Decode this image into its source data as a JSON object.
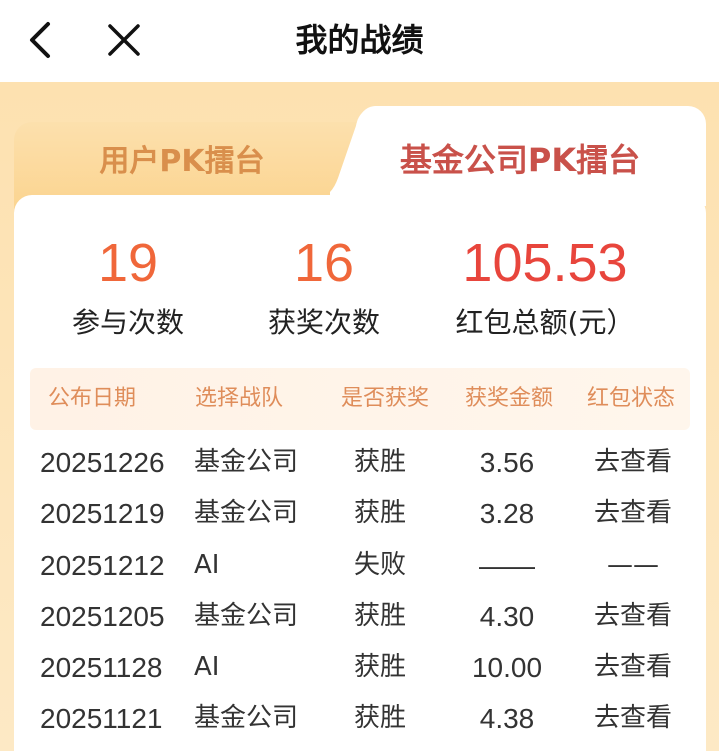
{
  "header": {
    "title": "我的战绩",
    "back_icon": "chevron-left-icon",
    "close_icon": "close-icon"
  },
  "tabs": [
    {
      "label": "用户PK擂台",
      "active": false
    },
    {
      "label": "基金公司PK擂台",
      "active": true
    }
  ],
  "stats": [
    {
      "value": "19",
      "label": "参与次数"
    },
    {
      "value": "16",
      "label": "获奖次数"
    },
    {
      "value": "105.53",
      "label": "红包总额(元）"
    }
  ],
  "table": {
    "columns": [
      "公布日期",
      "选择战队",
      "是否获奖",
      "获奖金额",
      "红包状态"
    ],
    "rows": [
      {
        "date": "20251226",
        "team": "基金公司",
        "result": "获胜",
        "amount": "3.56",
        "status": "去查看"
      },
      {
        "date": "20251219",
        "team": "基金公司",
        "result": "获胜",
        "amount": "3.28",
        "status": "去查看"
      },
      {
        "date": "20251212",
        "team": "AI",
        "result": "失败",
        "amount": "——",
        "status": "——"
      },
      {
        "date": "20251205",
        "team": "基金公司",
        "result": "获胜",
        "amount": "4.30",
        "status": "去查看"
      },
      {
        "date": "20251128",
        "team": "AI",
        "result": "获胜",
        "amount": "10.00",
        "status": "去查看"
      },
      {
        "date": "20251121",
        "team": "基金公司",
        "result": "获胜",
        "amount": "4.38",
        "status": "去查看"
      }
    ]
  },
  "colors": {
    "accent_orange": "#f0673a",
    "accent_red": "#e8453c",
    "tab_active_text": "#c9514a",
    "tab_inactive_text": "#d98f4c",
    "header_text": "#df8d5a",
    "background_peach": "#fde1b0"
  }
}
